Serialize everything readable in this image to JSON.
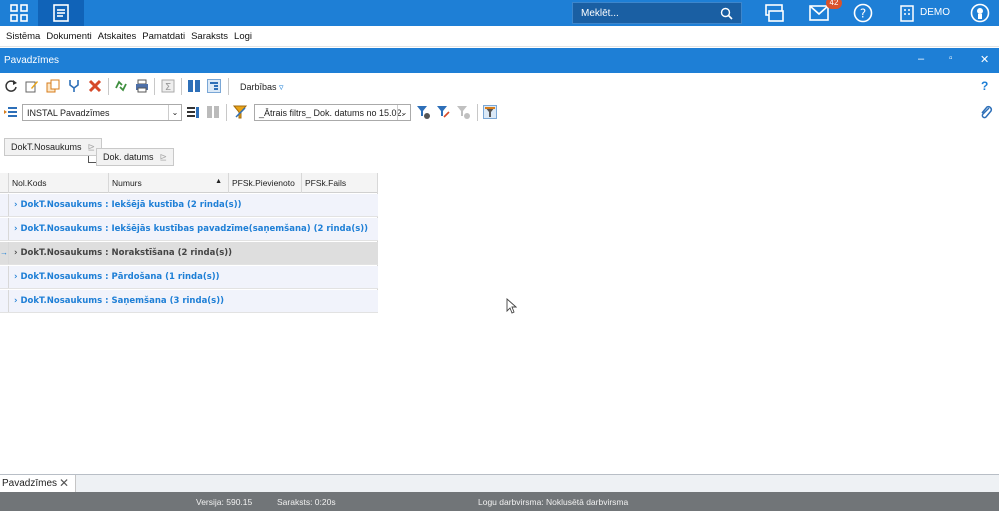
{
  "topbar": {
    "search_placeholder": "Meklēt...",
    "notification_count": "42",
    "company_label": "DEMO"
  },
  "menu": [
    "Sistēma",
    "Dokumenti",
    "Atskaites",
    "Pamatdati",
    "Saraksts",
    "Logi"
  ],
  "window": {
    "title": "Pavadzīmes"
  },
  "toolbar": {
    "actions_label": "Darbības",
    "layout_select": "INSTAL Pavadzīmes",
    "filter_select": "_Ātrais filtrs_ Dok. datums no 15.02."
  },
  "group_panel": {
    "group1": "DokT.Nosaukums",
    "group2": "Dok. datums"
  },
  "grid": {
    "columns": [
      "Nol.Kods",
      "Numurs",
      "PFSk.Pievienoto",
      "PFSk.Fails"
    ],
    "rows": [
      "DokT.Nosaukums : Iekšējā kustība (2 rinda(s))",
      "DokT.Nosaukums : Iekšējās kustības pavadzīme(saņemšana) (2 rinda(s))",
      "DokT.Nosaukums : Norakstīšana (2 rinda(s))",
      "DokT.Nosaukums : Pārdošana (1 rinda(s))",
      "DokT.Nosaukums : Saņemšana (3 rinda(s))"
    ]
  },
  "bottom": {
    "tab_label": "Pavadzīmes",
    "version": "Versija: 590.15",
    "list_time": "Saraksts: 0:20s",
    "workspace": "Logu darbvirsma: Noklusētā darbvirsma"
  },
  "colors": {
    "accent": "#1e7fd6",
    "status_bar": "#717578",
    "badge": "#d9532c"
  }
}
